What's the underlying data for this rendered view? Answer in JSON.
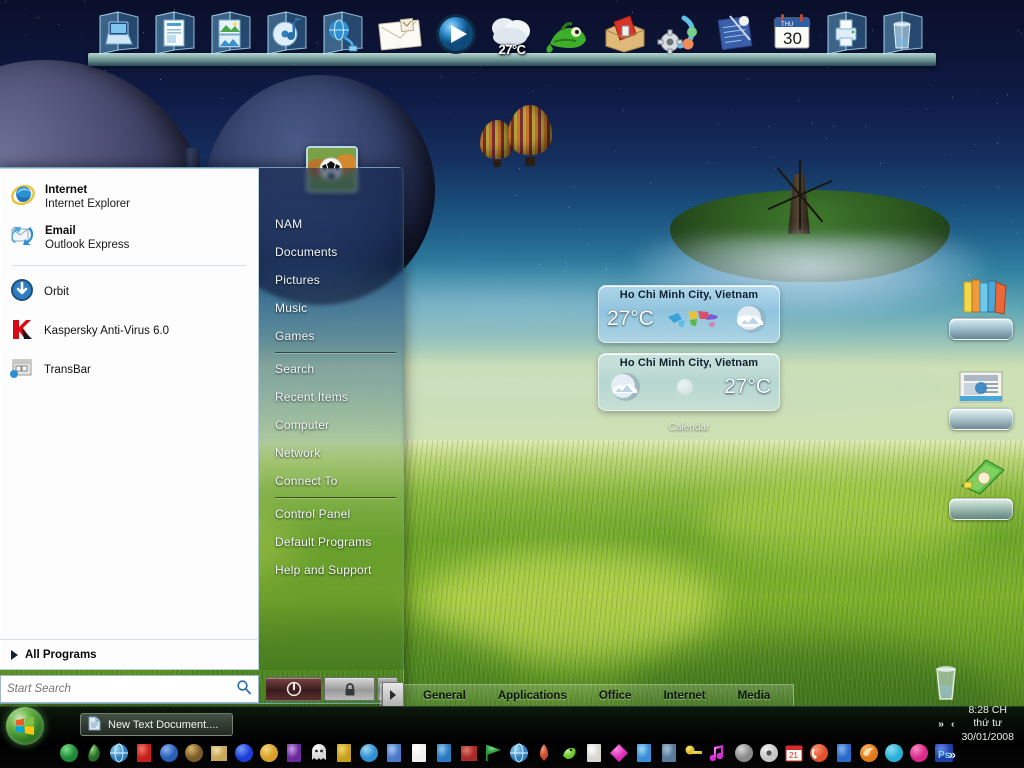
{
  "desktop": {
    "wallpaper_description": "Floating island with windmill over green wheat field, night sky with planets and hot air balloons",
    "shortcuts": [
      {
        "name": "books-shortcut",
        "label": ""
      },
      {
        "name": "newspaper-shortcut",
        "label": ""
      },
      {
        "name": "green-book-shortcut",
        "label": ""
      },
      {
        "name": "recycle-glass-shortcut",
        "label": ""
      }
    ]
  },
  "dock": {
    "items": [
      {
        "icon": "computer-folder-icon",
        "label": "Computer"
      },
      {
        "icon": "documents-folder-icon",
        "label": "Documents"
      },
      {
        "icon": "pictures-folder-icon",
        "label": "Pictures"
      },
      {
        "icon": "music-folder-icon",
        "label": "Music"
      },
      {
        "icon": "network-folder-icon",
        "label": "Network"
      },
      {
        "icon": "mail-envelope-icon",
        "label": "Mail"
      },
      {
        "icon": "media-player-icon",
        "label": "Media Player"
      },
      {
        "icon": "weather-cloud-icon",
        "label": "Weather"
      },
      {
        "icon": "gecko-mascot-icon",
        "label": "Gecko"
      },
      {
        "icon": "toolbox-icon",
        "label": "Toolbox"
      },
      {
        "icon": "settings-gear-icon",
        "label": "Settings"
      },
      {
        "icon": "notepad-icon",
        "label": "Notepad"
      },
      {
        "icon": "calendar-icon",
        "label": "Calendar"
      },
      {
        "icon": "printer-folder-icon",
        "label": "Printers"
      },
      {
        "icon": "recycle-bin-icon",
        "label": "Recycle Bin"
      }
    ],
    "weather_temp": "27°C",
    "calendar_day_label": "THU",
    "calendar_day_number": "30"
  },
  "gadgets": {
    "weather_1": {
      "location": "Ho Chi Minh City, Vietnam",
      "temperature": "27°C",
      "condition_icon": "partly-cloudy-icon"
    },
    "weather_2": {
      "location": "Ho Chi Minh City, Vietnam",
      "temperature": "27°C",
      "condition_icon": "partly-cloudy-icon"
    },
    "calendar_label": "Calendar"
  },
  "start_menu": {
    "avatar_name": "soccer-ball-avatar",
    "pinned": [
      {
        "icon": "internet-explorer-icon",
        "title": "Internet",
        "subtitle": "Internet Explorer"
      },
      {
        "icon": "outlook-express-icon",
        "title": "Email",
        "subtitle": "Outlook Express"
      }
    ],
    "programs": [
      {
        "icon": "orbit-downloader-icon",
        "label": "Orbit"
      },
      {
        "icon": "kaspersky-icon",
        "label": "Kaspersky Anti-Virus 6.0"
      },
      {
        "icon": "transbar-icon",
        "label": "TransBar"
      }
    ],
    "all_programs_label": "All Programs",
    "search": {
      "placeholder": "Start Search",
      "value": "",
      "icon": "search-icon"
    },
    "right_items": [
      "NAM",
      "Documents",
      "Pictures",
      "Music",
      "Games",
      "Search",
      "Recent Items",
      "Computer",
      "Network",
      "Connect To",
      "Control Panel",
      "Default Programs",
      "Help and Support"
    ],
    "separator_after": [
      4,
      9
    ],
    "power_buttons": [
      {
        "name": "power-button",
        "icon": "power-icon"
      },
      {
        "name": "lock-button",
        "icon": "lock-icon"
      },
      {
        "name": "more-options-button",
        "icon": "chevron-right-icon"
      }
    ]
  },
  "transbar": {
    "tabs": [
      "General",
      "Applications",
      "Office",
      "Internet",
      "Media"
    ],
    "handle_icon": "drag-handle-icon"
  },
  "taskbar": {
    "start_orb": "windows-start-orb",
    "windows": [
      {
        "icon": "text-document-icon",
        "title": "New Text Document...."
      }
    ],
    "tray": {
      "show_hidden_icon": "chevron-double-right-icon",
      "expand_icon": "chevron-left-icon",
      "time": "8:28 CH",
      "weekday": "thứ tư",
      "date": "30/01/2008"
    },
    "quicklaunch_count": 32,
    "overflow_icon": "chevron-double-right-icon"
  },
  "colors": {
    "sky_top": "#0a0f2a",
    "sky_mid": "#1b5480",
    "field_green": "#6ca628",
    "accent_blue": "#76aad2",
    "start_orb_green": "#2f7a22",
    "power_red": "#7a4444",
    "menu_white": "#fdfdfd"
  }
}
